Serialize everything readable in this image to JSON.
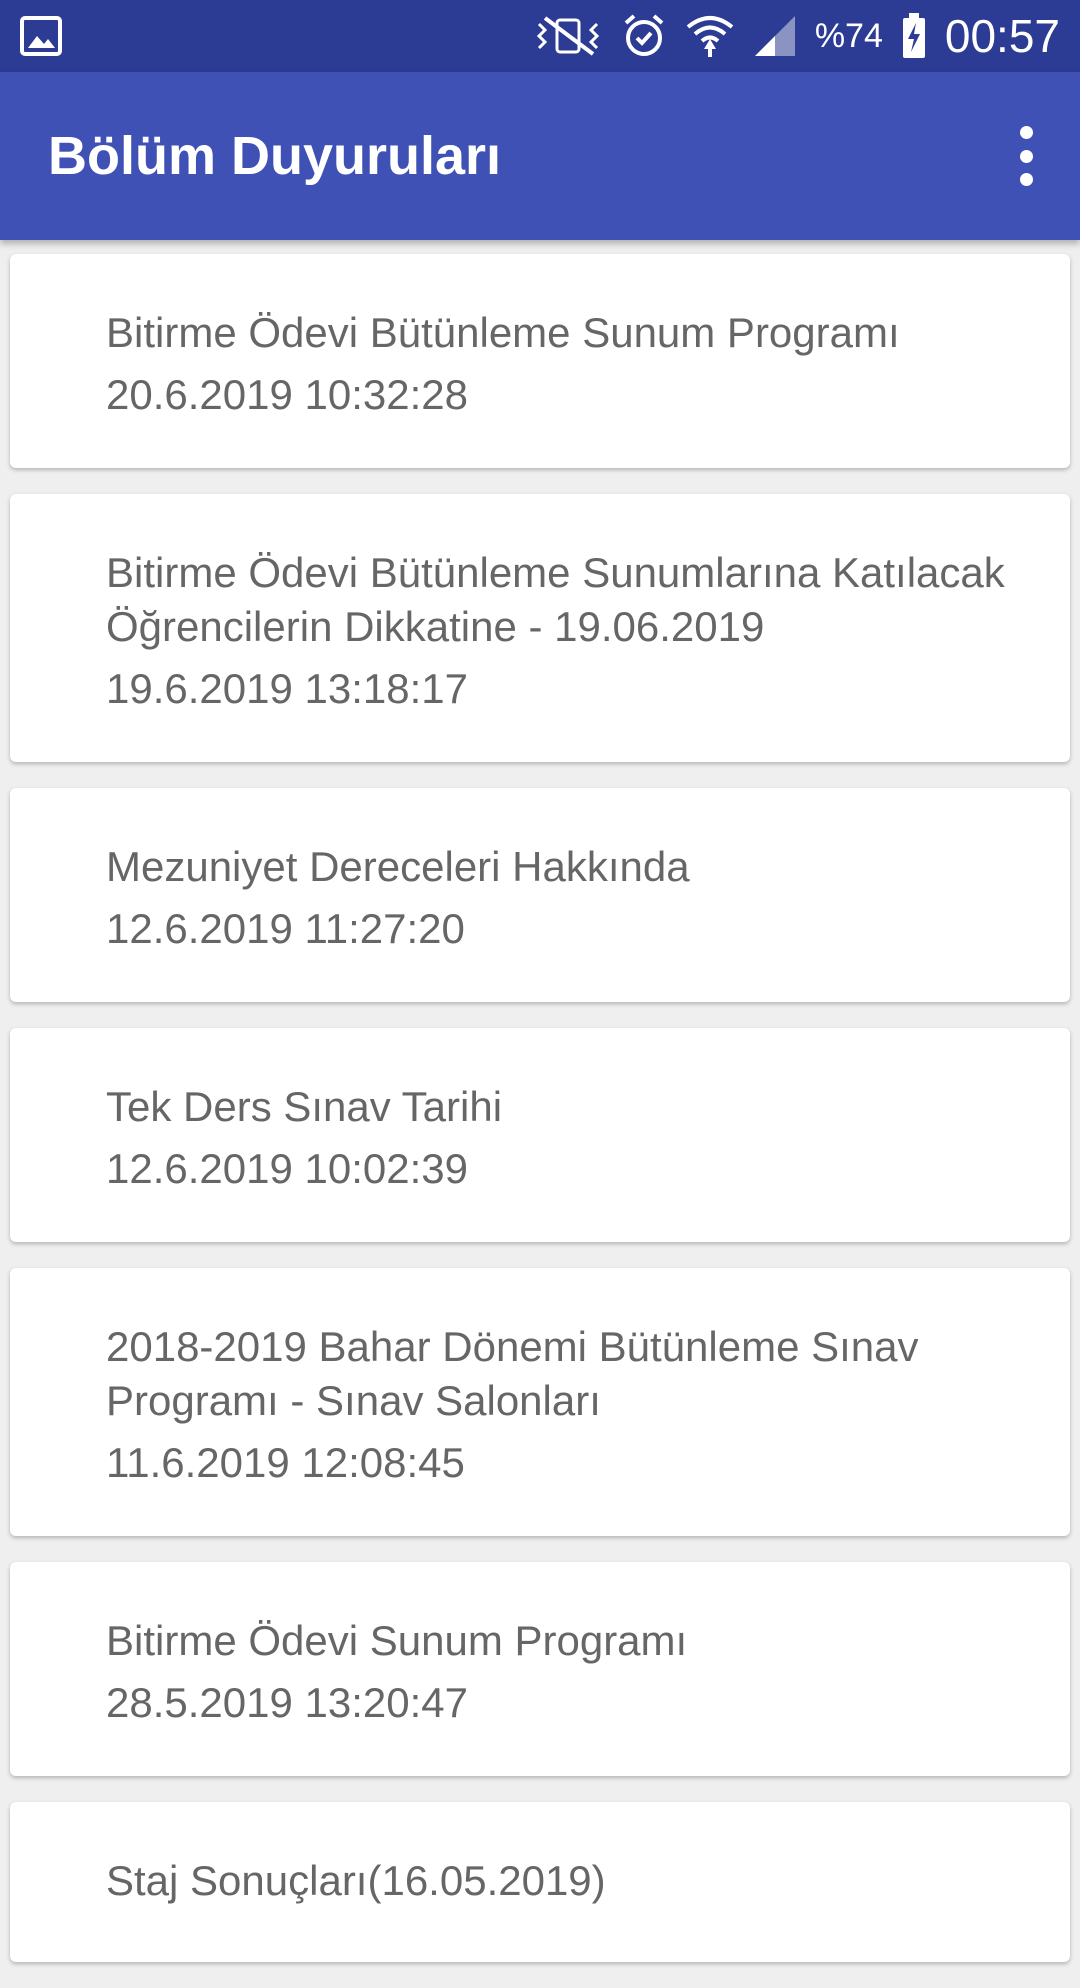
{
  "status_bar": {
    "battery_percent": "%74",
    "time": "00:57",
    "icons": [
      "gallery-icon",
      "vibrate-mute-icon",
      "alarm-icon",
      "wifi-icon",
      "signal-icon",
      "battery-charging-icon"
    ]
  },
  "app_bar": {
    "title": "Bölüm Duyuruları",
    "menu_icon": "more-vert-icon"
  },
  "colors": {
    "status_bar": "#2c3b93",
    "app_bar": "#3f51b5",
    "background": "#efefef",
    "card": "#ffffff",
    "text": "#666666"
  },
  "announcements": [
    {
      "title": "Bitirme Ödevi Bütünleme Sunum Programı",
      "date": "20.6.2019 10:32:28"
    },
    {
      "title": "Bitirme Ödevi Bütünleme Sunumlarına Katılacak Öğrencilerin Dikkatine - 19.06.2019",
      "date": "19.6.2019 13:18:17"
    },
    {
      "title": "Mezuniyet Dereceleri Hakkında",
      "date": "12.6.2019 11:27:20"
    },
    {
      "title": "Tek Ders Sınav Tarihi",
      "date": "12.6.2019 10:02:39"
    },
    {
      "title": "2018-2019 Bahar Dönemi Bütünleme Sınav Programı - Sınav Salonları",
      "date": "11.6.2019 12:08:45"
    },
    {
      "title": "Bitirme Ödevi Sunum Programı",
      "date": "28.5.2019 13:20:47"
    },
    {
      "title": "Staj Sonuçları(16.05.2019)",
      "date": ""
    }
  ]
}
